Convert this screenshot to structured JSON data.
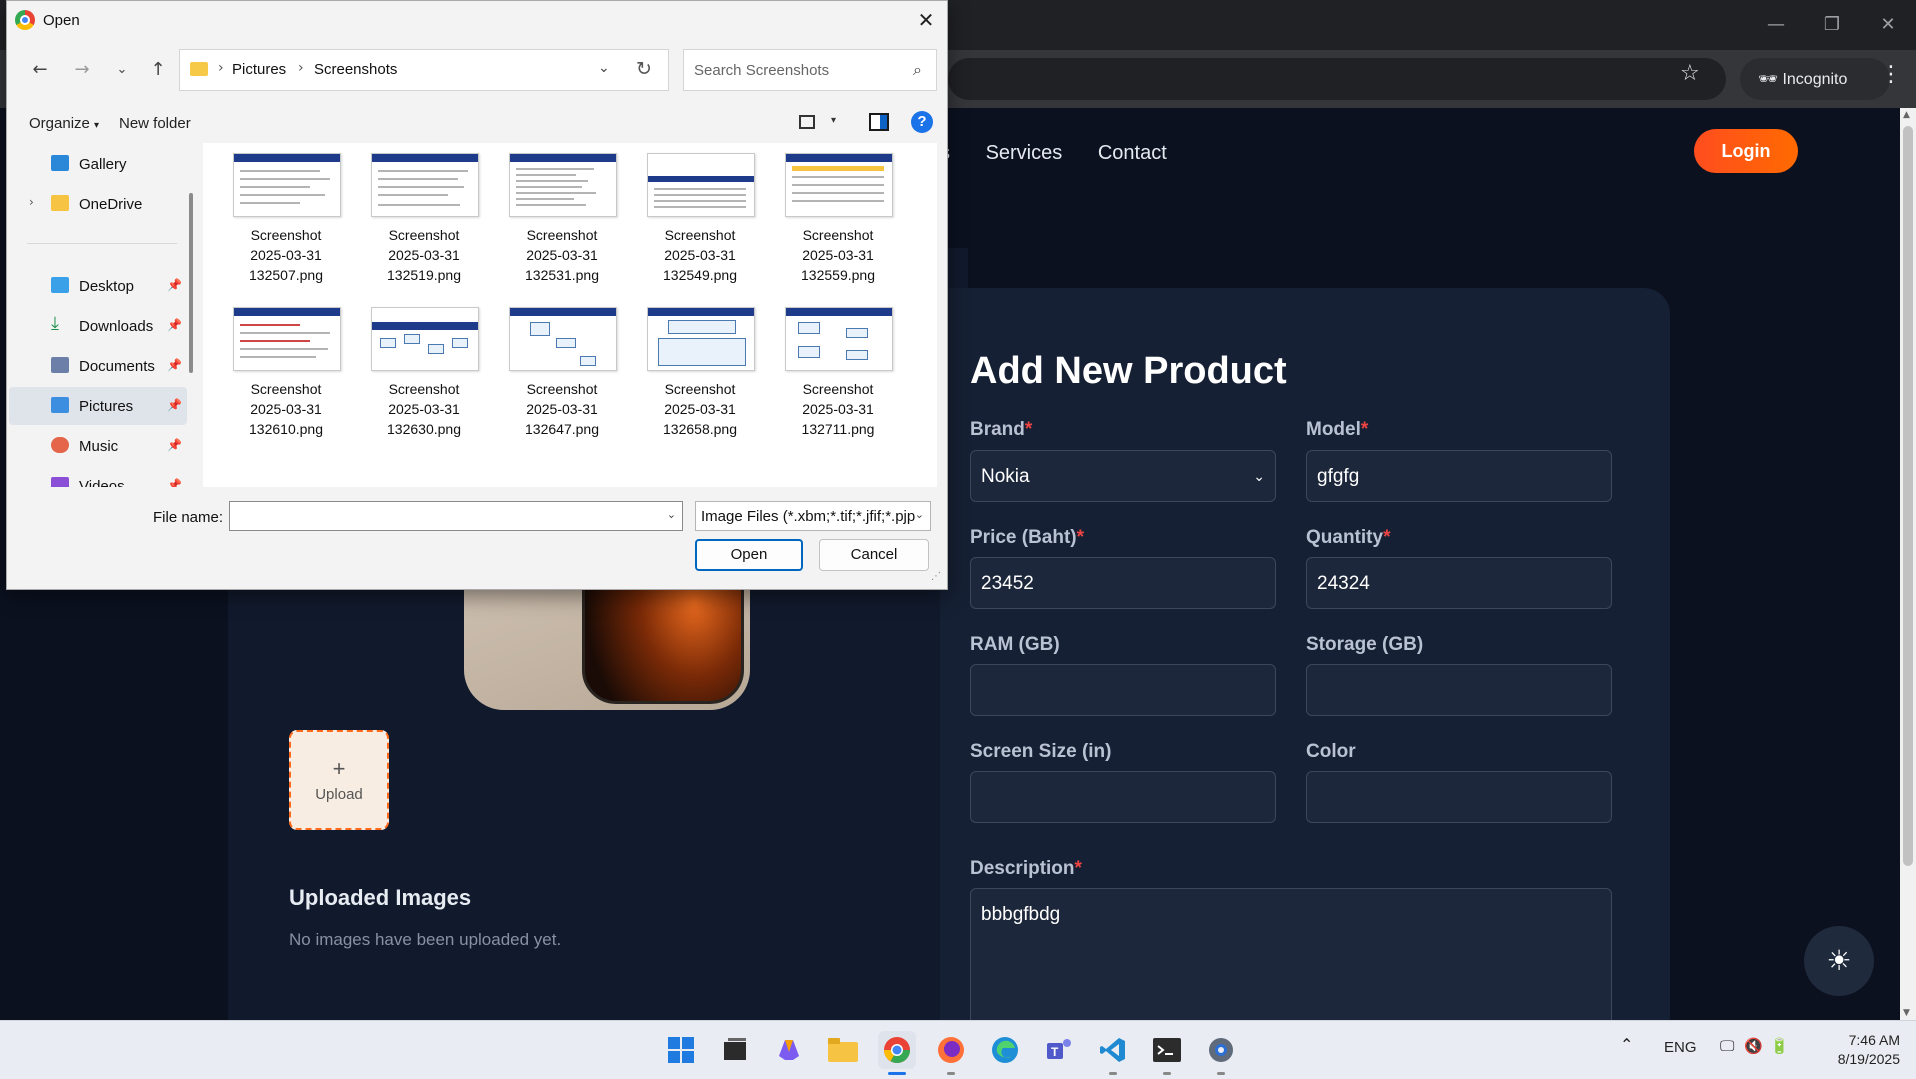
{
  "browser": {
    "window_controls": {
      "minimize": "—",
      "restore": "❐",
      "close": "✕"
    },
    "incognito_label": "Incognito",
    "star_icon": "☆",
    "menu_icon": "⋮"
  },
  "site": {
    "nav": {
      "partial": "s",
      "services": "Services",
      "contact": "Contact"
    },
    "login": "Login",
    "upload": {
      "plus": "+",
      "label": "Upload"
    },
    "uploaded_title": "Uploaded Images",
    "uploaded_empty": "No images have been uploaded yet.",
    "form": {
      "title": "Add New Product",
      "required_mark": "*",
      "brand": {
        "label": "Brand",
        "value": "Nokia"
      },
      "model": {
        "label": "Model",
        "value": "gfgfg"
      },
      "price": {
        "label": "Price (Baht)",
        "value": "23452"
      },
      "quantity": {
        "label": "Quantity",
        "value": "24324"
      },
      "ram": {
        "label": "RAM (GB)",
        "value": ""
      },
      "storage": {
        "label": "Storage (GB)",
        "value": ""
      },
      "screen": {
        "label": "Screen Size (in)",
        "value": ""
      },
      "color": {
        "label": "Color",
        "value": ""
      },
      "description": {
        "label": "Description",
        "value": "bbbgfbdg"
      }
    },
    "theme_toggle_icon": "☀",
    "accent_color": "#ff5a14"
  },
  "dialog": {
    "title": "Open",
    "breadcrumb": [
      "Pictures",
      "Screenshots"
    ],
    "search_placeholder": "Search Screenshots",
    "organize": "Organize",
    "new_folder": "New folder",
    "help": "?",
    "nav_pane": [
      {
        "label": "Gallery",
        "icon": "gallery-icon"
      },
      {
        "label": "OneDrive",
        "icon": "folder-icon"
      },
      {
        "label": "Desktop",
        "icon": "desktop-icon"
      },
      {
        "label": "Downloads",
        "icon": "download-icon"
      },
      {
        "label": "Documents",
        "icon": "documents-icon"
      },
      {
        "label": "Pictures",
        "icon": "pictures-icon"
      },
      {
        "label": "Music",
        "icon": "music-icon"
      },
      {
        "label": "Videos",
        "icon": "videos-icon"
      }
    ],
    "files": [
      {
        "l1": "Screenshot",
        "l2": "2025-03-31",
        "l3": "132507.png"
      },
      {
        "l1": "Screenshot",
        "l2": "2025-03-31",
        "l3": "132519.png"
      },
      {
        "l1": "Screenshot",
        "l2": "2025-03-31",
        "l3": "132531.png"
      },
      {
        "l1": "Screenshot",
        "l2": "2025-03-31",
        "l3": "132549.png"
      },
      {
        "l1": "Screenshot",
        "l2": "2025-03-31",
        "l3": "132559.png"
      },
      {
        "l1": "Screenshot",
        "l2": "2025-03-31",
        "l3": "132610.png"
      },
      {
        "l1": "Screenshot",
        "l2": "2025-03-31",
        "l3": "132630.png"
      },
      {
        "l1": "Screenshot",
        "l2": "2025-03-31",
        "l3": "132647.png"
      },
      {
        "l1": "Screenshot",
        "l2": "2025-03-31",
        "l3": "132658.png"
      },
      {
        "l1": "Screenshot",
        "l2": "2025-03-31",
        "l3": "132711.png"
      }
    ],
    "file_name_label": "File name:",
    "file_name_value": "",
    "file_type": "Image Files (*.xbm;*.tif;*.jfif;*.pjp",
    "open_button": "Open",
    "cancel_button": "Cancel"
  },
  "taskbar": {
    "apps": [
      "start-icon",
      "task-view-icon",
      "copilot-icon",
      "file-explorer-icon",
      "chrome-icon",
      "firefox-icon",
      "edge-icon",
      "teams-icon",
      "vscode-icon",
      "terminal-icon",
      "settings-icon"
    ],
    "tray": {
      "chevron": "⌃",
      "lang": "ENG"
    },
    "time": "7:46 AM",
    "date": "8/19/2025"
  }
}
